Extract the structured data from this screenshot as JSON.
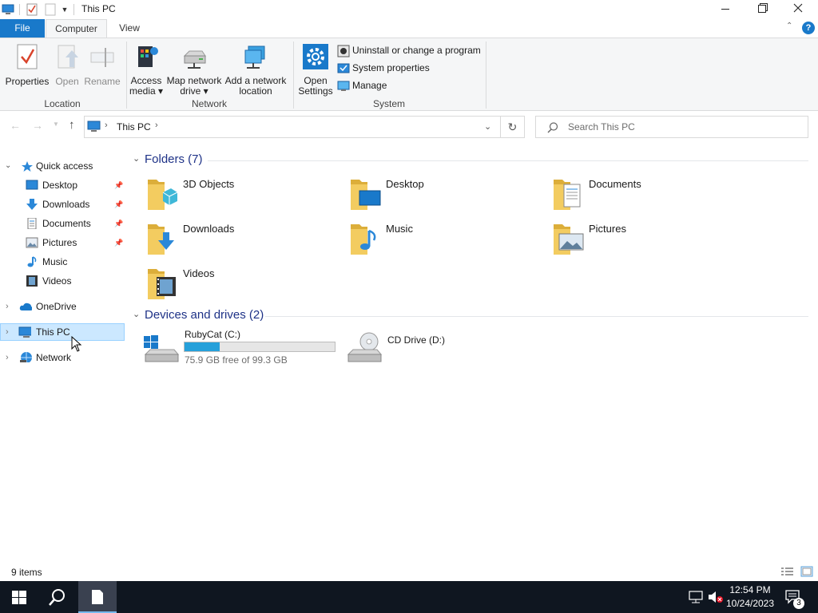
{
  "window": {
    "title": "This PC",
    "controls": {
      "minimize": "minimize",
      "maximize": "maximize",
      "close": "close"
    }
  },
  "ribbon_tabs": [
    {
      "label": "File",
      "active": false
    },
    {
      "label": "Computer",
      "active": true
    },
    {
      "label": "View",
      "active": false
    }
  ],
  "ribbon": {
    "location": {
      "label": "Location",
      "buttons": [
        {
          "label": "Properties",
          "enabled": true
        },
        {
          "label": "Open",
          "enabled": false
        },
        {
          "label": "Rename",
          "enabled": false
        }
      ]
    },
    "network": {
      "label": "Network",
      "buttons": [
        {
          "line1": "Access",
          "line2": "media ▾"
        },
        {
          "line1": "Map network",
          "line2": "drive ▾"
        },
        {
          "line1": "Add a network",
          "line2": "location"
        }
      ]
    },
    "system": {
      "label": "System",
      "open_settings": {
        "line1": "Open",
        "line2": "Settings"
      },
      "items": [
        {
          "label": "Uninstall or change a program"
        },
        {
          "label": "System properties"
        },
        {
          "label": "Manage"
        }
      ]
    }
  },
  "address": {
    "breadcrumb": "This PC",
    "search_placeholder": "Search This PC"
  },
  "nav": {
    "quick_access": "Quick access",
    "quick_items": [
      {
        "label": "Desktop",
        "pinned": true
      },
      {
        "label": "Downloads",
        "pinned": true
      },
      {
        "label": "Documents",
        "pinned": true
      },
      {
        "label": "Pictures",
        "pinned": true
      },
      {
        "label": "Music",
        "pinned": false
      },
      {
        "label": "Videos",
        "pinned": false
      }
    ],
    "onedrive": "OneDrive",
    "this_pc": "This PC",
    "network": "Network"
  },
  "content": {
    "folders_header": "Folders (7)",
    "folders": [
      {
        "name": "3D Objects"
      },
      {
        "name": "Desktop"
      },
      {
        "name": "Documents"
      },
      {
        "name": "Downloads"
      },
      {
        "name": "Music"
      },
      {
        "name": "Pictures"
      },
      {
        "name": "Videos"
      }
    ],
    "drives_header": "Devices and drives (2)",
    "drives": [
      {
        "name": "RubyCat (C:)",
        "free": "75.9 GB free of 99.3 GB",
        "used_fraction": 0.236
      },
      {
        "name": "CD Drive (D:)"
      }
    ]
  },
  "status": {
    "items": "9 items"
  },
  "taskbar": {
    "time": "12:54 PM",
    "date": "10/24/2023",
    "notification_count": "3"
  },
  "colors": {
    "accent": "#1979ca",
    "selection": "#cce8ff",
    "folder": "#f3cc60",
    "drive_bar": "#26a0da",
    "taskbar": "#0f1620"
  }
}
